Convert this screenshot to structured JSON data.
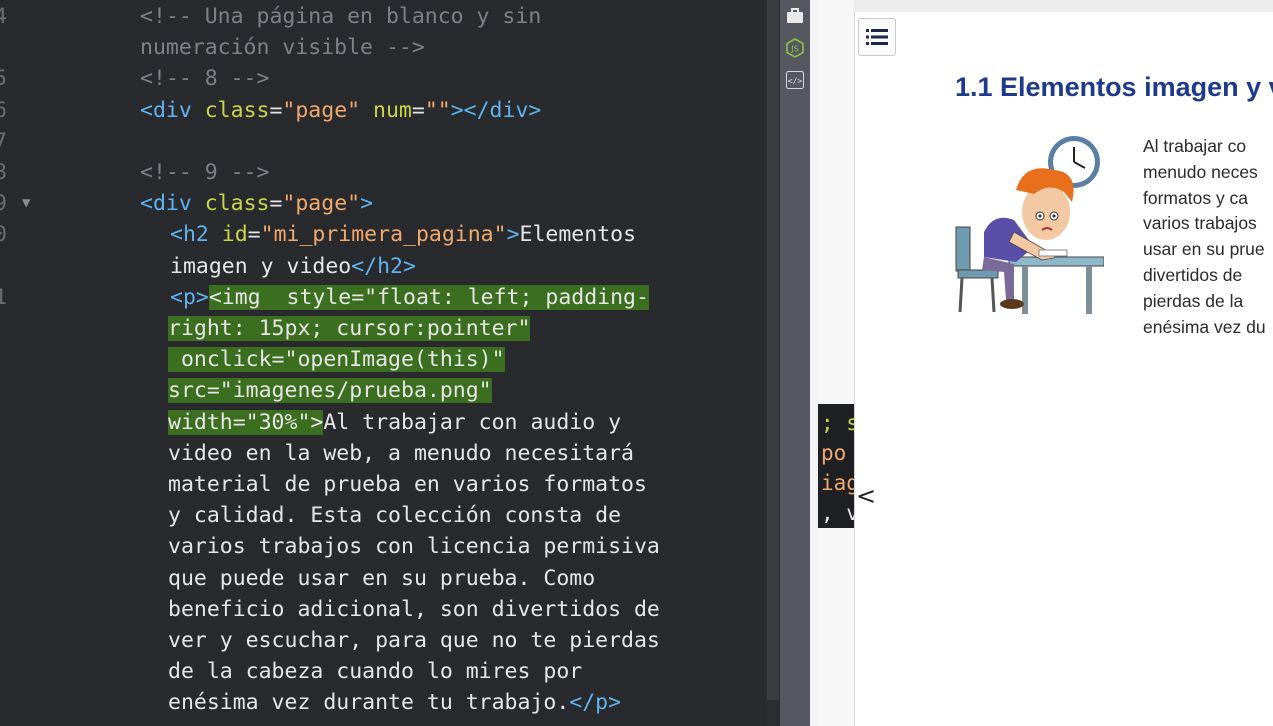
{
  "editor": {
    "lines": [
      {
        "num": "4",
        "segments": [
          {
            "t": "<!-- Una página en blanco y sin",
            "c": "cmt"
          }
        ]
      },
      {
        "num": "",
        "segments": [
          {
            "t": "numeración visible -->",
            "c": "cmt"
          }
        ]
      },
      {
        "num": "5",
        "segments": [
          {
            "t": "<!-- 8 -->",
            "c": "cmt"
          }
        ]
      },
      {
        "num": "6",
        "segments": [
          {
            "t": "<div ",
            "c": "tag"
          },
          {
            "t": "class",
            "c": "attr"
          },
          {
            "t": "=",
            "c": "txt"
          },
          {
            "t": "\"page\"",
            "c": "str"
          },
          {
            "t": " num",
            "c": "attr"
          },
          {
            "t": "=",
            "c": "txt"
          },
          {
            "t": "\"\"",
            "c": "str"
          },
          {
            "t": "></div>",
            "c": "tag"
          }
        ]
      },
      {
        "num": "7",
        "segments": []
      },
      {
        "num": "8",
        "segments": [
          {
            "t": "<!-- 9 -->",
            "c": "cmt"
          }
        ]
      },
      {
        "num": "9",
        "fold": true,
        "segments": [
          {
            "t": "<div ",
            "c": "tag"
          },
          {
            "t": "class",
            "c": "attr"
          },
          {
            "t": "=",
            "c": "txt"
          },
          {
            "t": "\"page\"",
            "c": "str"
          },
          {
            "t": ">",
            "c": "tag"
          }
        ]
      },
      {
        "num": "0",
        "segments": [
          {
            "t": "<h2 ",
            "c": "tag"
          },
          {
            "t": "id",
            "c": "attr"
          },
          {
            "t": "=",
            "c": "txt"
          },
          {
            "t": "\"mi_primera_pagina\"",
            "c": "str"
          },
          {
            "t": ">",
            "c": "tag"
          },
          {
            "t": "Elementos",
            "c": "txt"
          }
        ]
      },
      {
        "num": "",
        "segments": [
          {
            "t": "imagen y video",
            "c": "txt"
          },
          {
            "t": "</h2>",
            "c": "tag"
          }
        ]
      },
      {
        "num": "1",
        "segments": [
          {
            "t": "<p>",
            "c": "tag"
          },
          {
            "t": "<img  style=\"float: left; padding-",
            "c": "txt",
            "hl": true
          }
        ]
      },
      {
        "num": "",
        "segments": [
          {
            "t": "right: 15px; cursor:pointer\"",
            "c": "txt",
            "hl": true
          }
        ]
      },
      {
        "num": "",
        "segments": [
          {
            "t": " onclick=\"openImage(this)\"",
            "c": "txt",
            "hl": true
          }
        ]
      },
      {
        "num": "",
        "segments": [
          {
            "t": "src=\"imagenes/prueba.png\"",
            "c": "txt",
            "hl": true
          }
        ]
      },
      {
        "num": "",
        "segments": [
          {
            "t": "width=\"30%\">",
            "c": "txt",
            "hl": true
          },
          {
            "t": "Al trabajar con audio y",
            "c": "txt"
          }
        ]
      },
      {
        "num": "",
        "segments": [
          {
            "t": "video en la web, a menudo necesitará",
            "c": "txt"
          }
        ]
      },
      {
        "num": "",
        "segments": [
          {
            "t": "material de prueba en varios formatos",
            "c": "txt"
          }
        ]
      },
      {
        "num": "",
        "segments": [
          {
            "t": "y calidad. Esta colección consta de",
            "c": "txt"
          }
        ]
      },
      {
        "num": "",
        "segments": [
          {
            "t": "varios trabajos con licencia permisiva",
            "c": "txt"
          }
        ]
      },
      {
        "num": "",
        "segments": [
          {
            "t": "que puede usar en su prueba. Como",
            "c": "txt"
          }
        ]
      },
      {
        "num": "",
        "segments": [
          {
            "t": "beneficio adicional, son divertidos de",
            "c": "txt"
          }
        ]
      },
      {
        "num": "",
        "segments": [
          {
            "t": "ver y escuchar, para que no te pierdas",
            "c": "txt"
          }
        ]
      },
      {
        "num": "",
        "segments": [
          {
            "t": "de la cabeza cuando lo mires por",
            "c": "txt"
          }
        ]
      },
      {
        "num": "",
        "segments": [
          {
            "t": "enésima vez durante tu trabajo.",
            "c": "txt"
          },
          {
            "t": "</p>",
            "c": "tag"
          }
        ]
      }
    ],
    "indents": [
      140,
      140,
      140,
      140,
      140,
      140,
      140,
      170,
      170,
      170,
      168,
      168,
      168,
      168,
      168,
      168,
      168,
      168,
      168,
      168,
      168,
      168,
      168
    ]
  },
  "side_strip": {
    "icons": [
      "briefcase-icon",
      "node-js-icon",
      "code-icon"
    ],
    "js_label": "JS",
    "code_label": "</>"
  },
  "peek": {
    "lines": [
      "; s",
      "po",
      "iag",
      ", v"
    ]
  },
  "preview": {
    "toc_icon": "list-icon",
    "collapse_glyph": "<",
    "heading": "1.1 Elementos imagen y v",
    "paragraph_lines": [
      "Al trabajar co",
      "menudo neces",
      "formatos y ca",
      "varios trabajos",
      "usar en su prue",
      "divertidos de",
      "pierdas de la",
      "enésima vez du"
    ]
  }
}
